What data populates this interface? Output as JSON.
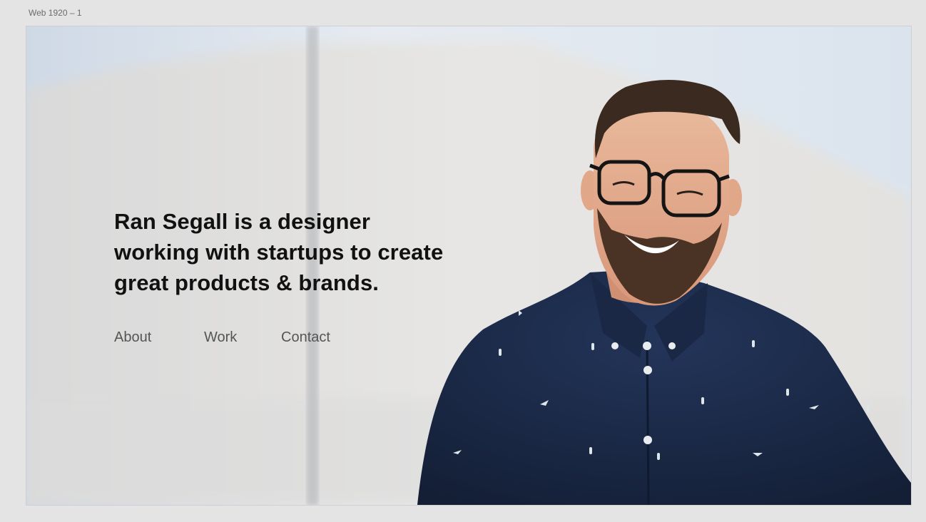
{
  "frame": {
    "label": "Web 1920 – 1"
  },
  "hero": {
    "headline_lines": [
      "Ran Segall is a designer",
      "working with startups to create",
      "great products & brands."
    ]
  },
  "nav": {
    "items": [
      {
        "label": "About"
      },
      {
        "label": "Work"
      },
      {
        "label": "Contact"
      }
    ]
  },
  "colors": {
    "headline": "#111111",
    "nav": "#555555",
    "shirt": "#1b2a45",
    "canvas": "#e4e4e4"
  }
}
